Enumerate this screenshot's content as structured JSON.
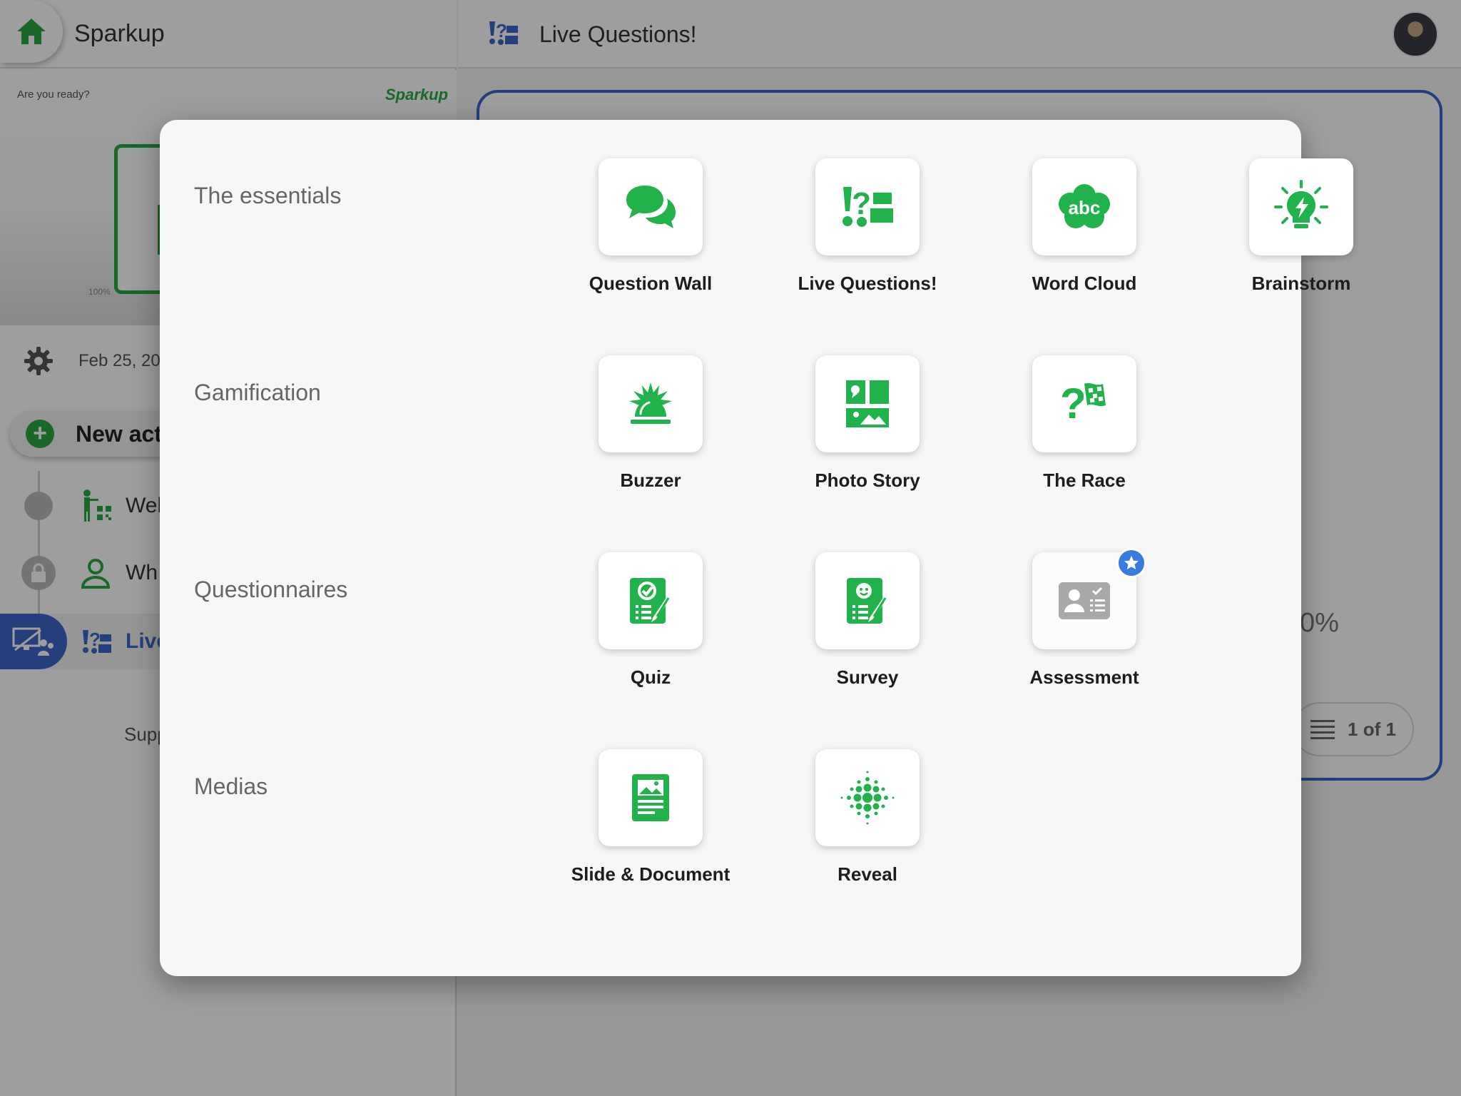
{
  "colors": {
    "brand_green": "#29a845",
    "active_blue": "#3a66c9",
    "premium_badge": "#3a7be0"
  },
  "app": {
    "title": "Sparkup",
    "preview": {
      "ready_text": "Are you ready?",
      "logo_text": "Sparkup",
      "percent": "100%"
    },
    "date": "Feb 25, 20",
    "new_activity_label": "New act",
    "activities": [
      {
        "label": "Wel",
        "icon": "qr-presenter-icon",
        "state": "done"
      },
      {
        "label": "Wh",
        "icon": "user-icon",
        "state": "locked"
      },
      {
        "label": "Live",
        "icon": "live-questions-icon",
        "state": "active"
      }
    ],
    "support_text": "Supp"
  },
  "header": {
    "title": "Live Questions!",
    "avatar_icon": "avatar"
  },
  "card": {
    "percent_fragment": "0%",
    "pager_text": "1 of 1"
  },
  "modal": {
    "sections": [
      {
        "title": "The essentials",
        "tiles": [
          {
            "label": "Question Wall",
            "icon": "speech-bubbles-icon"
          },
          {
            "label": "Live Questions!",
            "icon": "live-questions-icon"
          },
          {
            "label": "Word Cloud",
            "icon": "word-cloud-icon",
            "icon_text": "abc"
          },
          {
            "label": "Brainstorm",
            "icon": "lightbulb-icon"
          }
        ]
      },
      {
        "title": "Gamification",
        "tiles": [
          {
            "label": "Buzzer",
            "icon": "buzzer-icon"
          },
          {
            "label": "Photo Story",
            "icon": "photo-story-icon"
          },
          {
            "label": "The Race",
            "icon": "race-flag-icon"
          }
        ]
      },
      {
        "title": "Questionnaires",
        "tiles": [
          {
            "label": "Quiz",
            "icon": "quiz-icon"
          },
          {
            "label": "Survey",
            "icon": "survey-icon"
          },
          {
            "label": "Assessment",
            "icon": "assessment-icon",
            "premium_badge_icon": "star-icon"
          }
        ]
      },
      {
        "title": "Medias",
        "tiles": [
          {
            "label": "Slide & Document",
            "icon": "slide-document-icon"
          },
          {
            "label": "Reveal",
            "icon": "reveal-icon"
          }
        ]
      }
    ]
  }
}
